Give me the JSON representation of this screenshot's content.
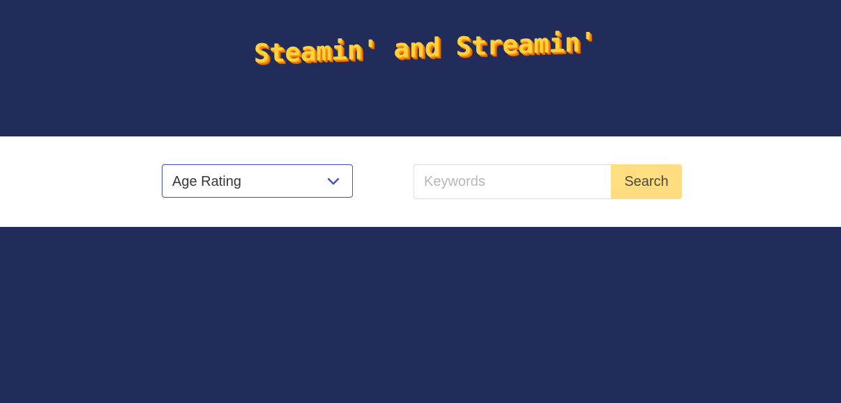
{
  "header": {
    "logo_text": "Steamin' and Streamin'"
  },
  "filters": {
    "age_rating": {
      "selected": "Age Rating"
    },
    "search": {
      "placeholder": "Keywords",
      "value": "",
      "button_label": "Search"
    }
  },
  "colors": {
    "background": "#212c5a",
    "logo_primary": "#ffd23a",
    "logo_shadow": "#e6700e",
    "select_border": "#3f51c4",
    "search_button": "#ffdd80"
  },
  "icons": {
    "select_chevron": "chevron-down-icon"
  }
}
